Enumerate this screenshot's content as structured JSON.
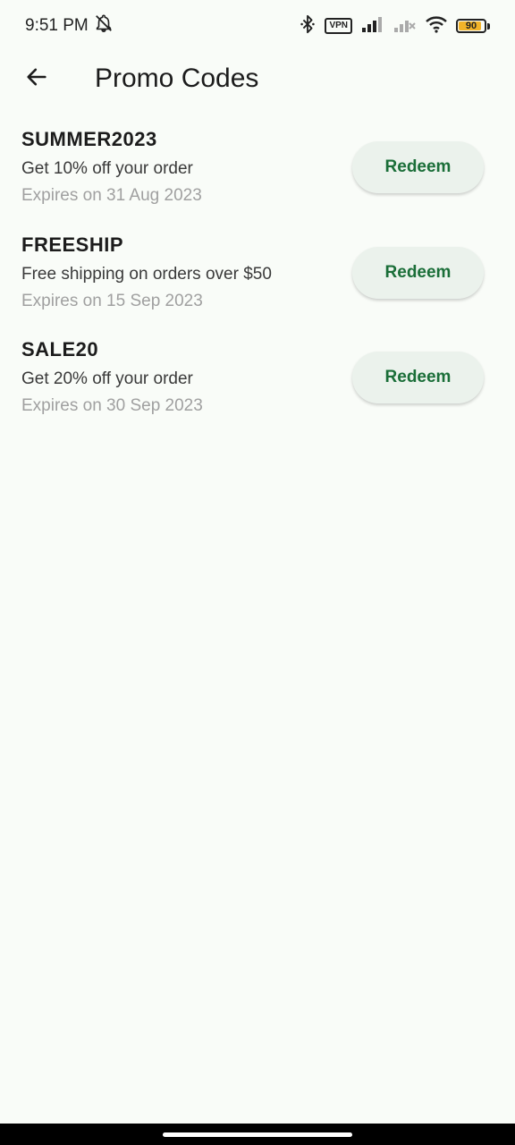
{
  "status_bar": {
    "time": "9:51 PM",
    "vpn_label": "VPN",
    "battery_level": "90",
    "battery_fraction": 0.9,
    "icons": [
      "bell-off-icon",
      "bluetooth-icon",
      "vpn-icon",
      "signal-icon",
      "signal-x-icon",
      "wifi-icon",
      "battery-icon"
    ]
  },
  "app_bar": {
    "title": "Promo Codes",
    "back_icon": "arrow-back-icon"
  },
  "promos": [
    {
      "code": "SUMMER2023",
      "description": "Get 10% off your order",
      "expiry": "Expires on 31 Aug 2023",
      "button_label": "Redeem"
    },
    {
      "code": "FREESHIP",
      "description": "Free shipping on orders over $50",
      "expiry": "Expires on 15 Sep 2023",
      "button_label": "Redeem"
    },
    {
      "code": "SALE20",
      "description": "Get 20% off your order",
      "expiry": "Expires on 30 Sep 2023",
      "button_label": "Redeem"
    }
  ],
  "colors": {
    "background": "#f9fcf8",
    "accent": "#1a6e38",
    "button_bg": "#ebf2ec",
    "battery": "#f2b329"
  }
}
